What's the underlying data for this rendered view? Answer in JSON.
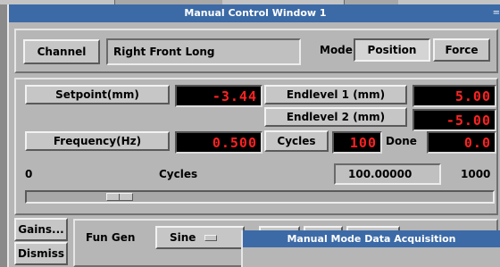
{
  "window": {
    "title": "Manual Control Window 1",
    "corner_mark": "="
  },
  "channel": {
    "button_label": "Channel",
    "value": "Right Front Long"
  },
  "mode": {
    "label": "Mode",
    "position_label": "Position",
    "force_label": "Force",
    "selected": "Position"
  },
  "setpoint": {
    "button_label": "Setpoint(mm)",
    "value": "-3.44"
  },
  "endlevel1": {
    "button_label": "Endlevel 1 (mm)",
    "value": "5.00"
  },
  "endlevel2": {
    "button_label": "Endlevel 2 (mm)",
    "value": "-5.00"
  },
  "frequency": {
    "button_label": "Frequency(Hz)",
    "value": "0.500"
  },
  "cycles": {
    "button_label": "Cycles",
    "value": "100",
    "done_label": "Done",
    "done_value": "0.0"
  },
  "cycles_slider": {
    "min_label": "0",
    "title": "Cycles",
    "value_text": "100.00000",
    "max_label": "1000",
    "value": 100,
    "min": 0,
    "max": 1000
  },
  "bottom": {
    "gains_label": "Gains...",
    "dismiss_label": "Dismiss",
    "fun_gen_label": "Fun Gen",
    "fun_gen_value": "Sine"
  },
  "daq_window": {
    "title": "Manual Mode Data Acquisition"
  },
  "colors": {
    "titlebar": "#3c6aa6",
    "led_text": "#ff2222",
    "led_bg": "#000000",
    "window_bg": "#b6b6b6"
  }
}
